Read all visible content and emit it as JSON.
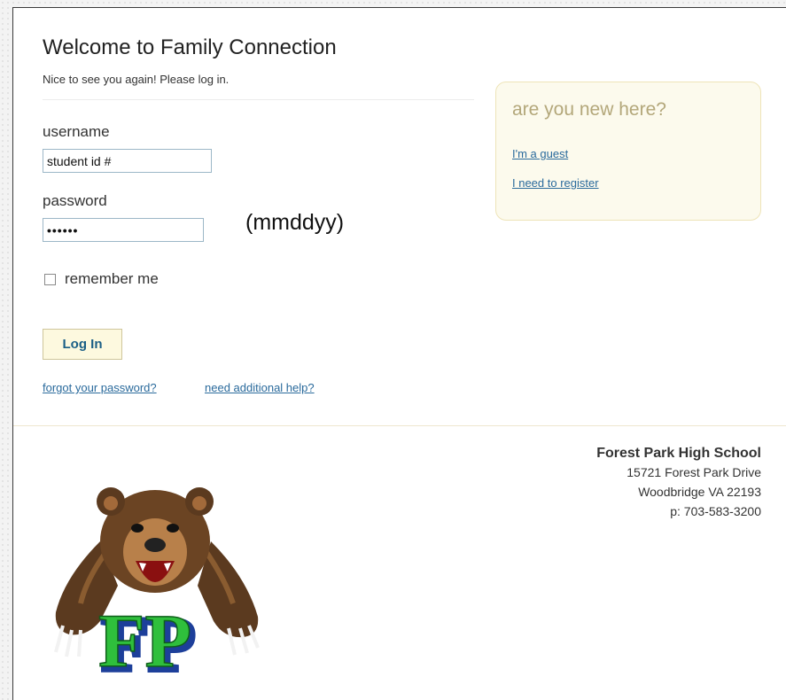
{
  "header": {
    "title": "Welcome to Family Connection",
    "subtitle": "Nice to see you again! Please log in."
  },
  "login": {
    "username_label": "username",
    "username_value": "student id #",
    "password_label": "password",
    "password_value": "••••••",
    "password_hint": "(mmddyy)",
    "remember_label": "remember me",
    "login_button": "Log In",
    "forgot_link": "forgot your password?",
    "help_link": "need additional help?"
  },
  "new_here": {
    "title": "are you new here?",
    "guest_link": "I'm a guest",
    "register_link": "I need to register"
  },
  "school": {
    "name": "Forest Park High School",
    "street": "15721 Forest Park Drive",
    "city": "Woodbridge VA 22193",
    "phone": "p: 703-583-3200",
    "logo_text": "FP"
  },
  "colors": {
    "link": "#2a6a9c",
    "button_bg": "#fdf9df",
    "panel_bg": "#fcfaed",
    "logo_green": "#2fbf3c",
    "logo_blue": "#1d3f9a"
  }
}
